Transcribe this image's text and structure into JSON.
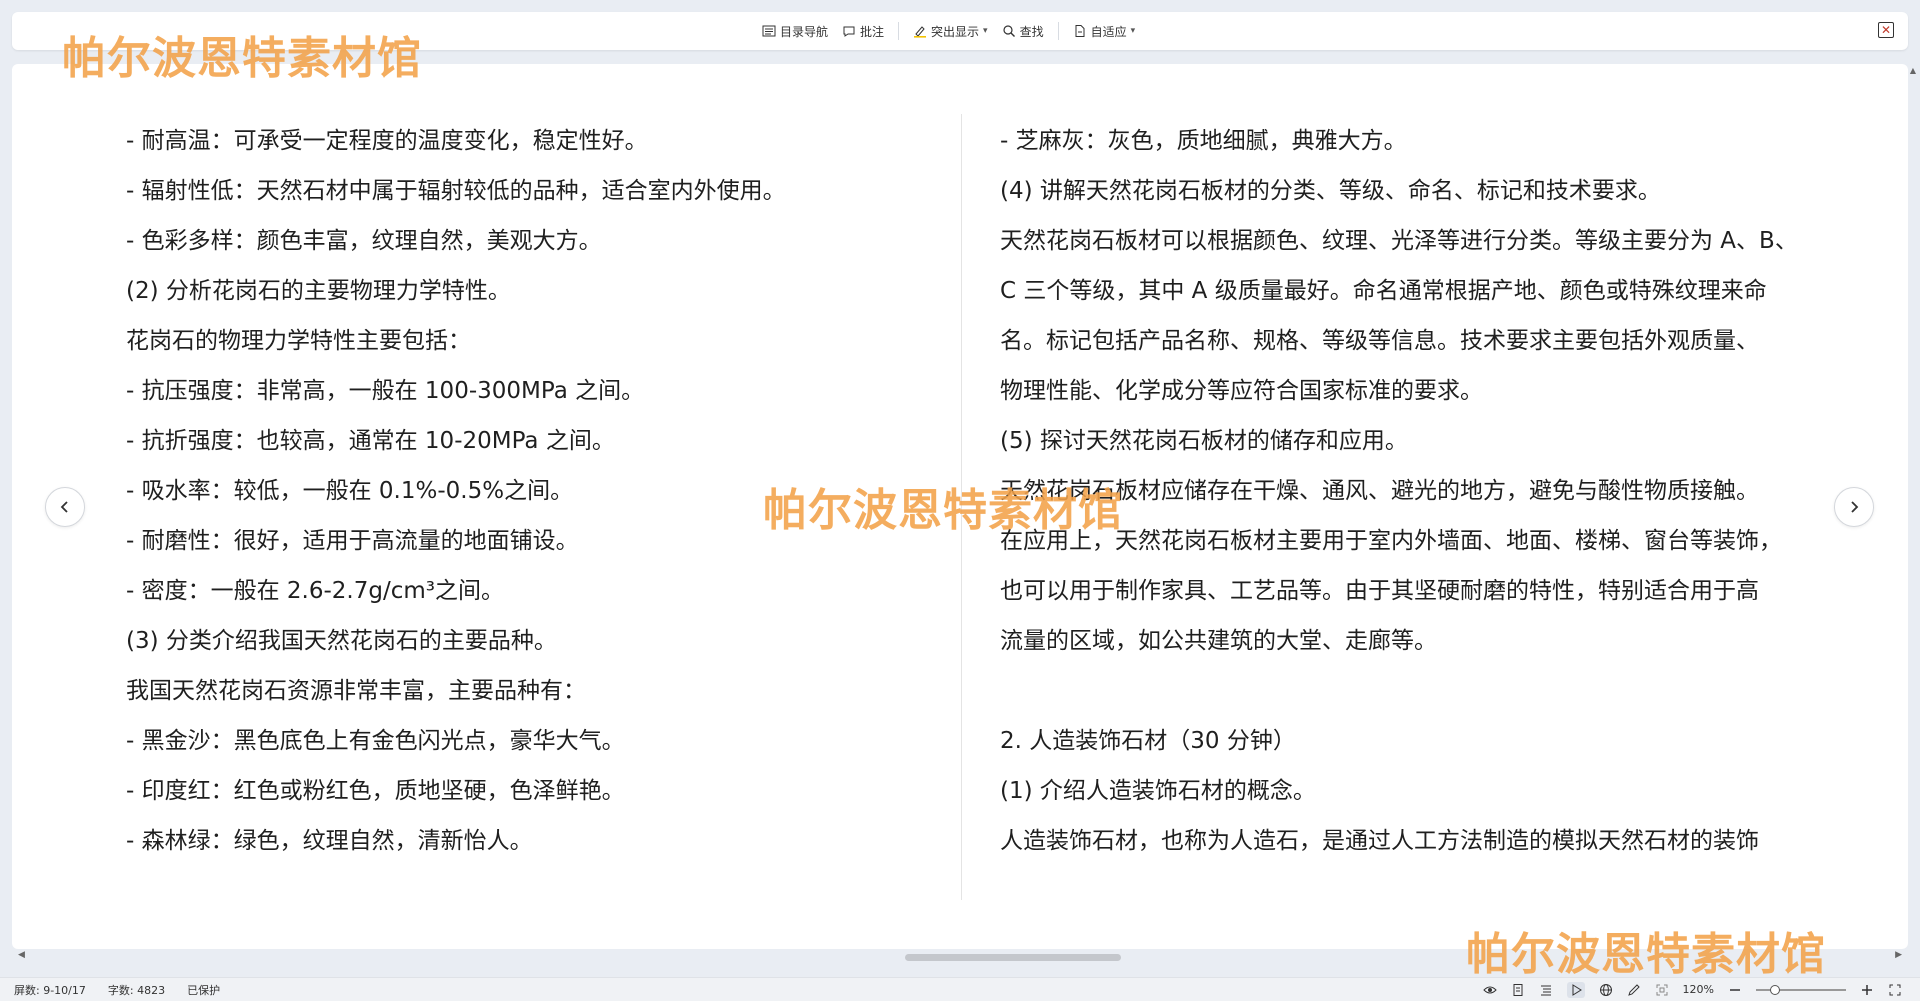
{
  "toolbar": {
    "toc_label": "目录导航",
    "comment_label": "批注",
    "highlight_label": "突出显示",
    "find_label": "查找",
    "fit_label": "自适应",
    "close_glyph": "✕"
  },
  "document": {
    "left_column": [
      "- 耐高温：可承受一定程度的温度变化，稳定性好。",
      "- 辐射性低：天然石材中属于辐射较低的品种，适合室内外使用。",
      "- 色彩多样：颜色丰富，纹理自然，美观大方。",
      "(2) 分析花岗石的主要物理力学特性。",
      "花岗石的物理力学特性主要包括：",
      "- 抗压强度：非常高，一般在 100-300MPa 之间。",
      "- 抗折强度：也较高，通常在 10-20MPa 之间。",
      "- 吸水率：较低，一般在 0.1%-0.5%之间。",
      "- 耐磨性：很好，适用于高流量的地面铺设。",
      "- 密度：一般在 2.6-2.7g/cm³之间。",
      "(3) 分类介绍我国天然花岗石的主要品种。",
      "我国天然花岗石资源非常丰富，主要品种有：",
      "- 黑金沙：黑色底色上有金色闪光点，豪华大气。",
      "- 印度红：红色或粉红色，质地坚硬，色泽鲜艳。",
      "- 森林绿：绿色，纹理自然，清新怡人。"
    ],
    "right_column": [
      "- 芝麻灰：灰色，质地细腻，典雅大方。",
      "(4) 讲解天然花岗石板材的分类、等级、命名、标记和技术要求。",
      "天然花岗石板材可以根据颜色、纹理、光泽等进行分类。等级主要分为 A、B、",
      "C 三个等级，其中 A 级质量最好。命名通常根据产地、颜色或特殊纹理来命",
      "名。标记包括产品名称、规格、等级等信息。技术要求主要包括外观质量、",
      "物理性能、化学成分等应符合国家标准的要求。",
      "(5) 探讨天然花岗石板材的储存和应用。",
      "天然花岗石板材应储存在干燥、通风、避光的地方，避免与酸性物质接触。",
      "在应用上，天然花岗石板材主要用于室内外墙面、地面、楼梯、窗台等装饰，",
      "也可以用于制作家具、工艺品等。由于其坚硬耐磨的特性，特别适合用于高",
      "流量的区域，如公共建筑的大堂、走廊等。",
      "",
      "2.  人造装饰石材（30 分钟）",
      "(1) 介绍人造装饰石材的概念。",
      "人造装饰石材，也称为人造石，是通过人工方法制造的模拟天然石材的装饰"
    ]
  },
  "status": {
    "page_count": "屏数: 9-10/17",
    "word_count": "字数: 4823",
    "protected": "已保护",
    "zoom": "120%",
    "zoom_level": 0.2
  },
  "watermark": {
    "text": "帕尔波恩特素材馆",
    "color": "#f3a24a"
  },
  "colors": {
    "accent_red": "#c0392b",
    "background": "#e9edf3"
  }
}
